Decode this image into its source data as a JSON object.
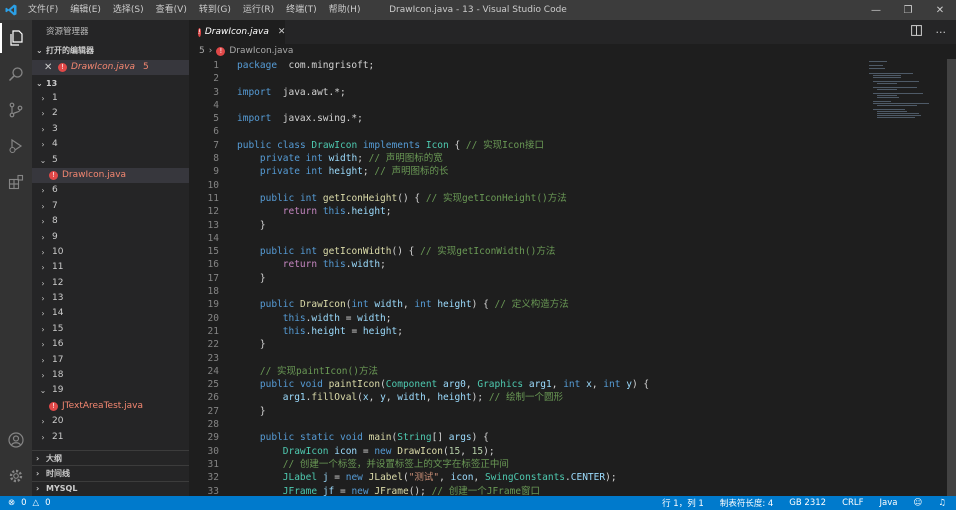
{
  "titlebar": {
    "menu": [
      "文件(F)",
      "编辑(E)",
      "选择(S)",
      "查看(V)",
      "转到(G)",
      "运行(R)",
      "终端(T)",
      "帮助(H)"
    ],
    "window_title": "DrawIcon.java - 13 - Visual Studio Code"
  },
  "sidebar": {
    "title": "资源管理器",
    "open_editors_label": "打开的编辑器",
    "open_editor": {
      "name": "DrawIcon.java",
      "badge": "5"
    },
    "workspace_label": "13",
    "tree": [
      {
        "label": "1",
        "type": "folder",
        "open": false
      },
      {
        "label": "2",
        "type": "folder",
        "open": false
      },
      {
        "label": "3",
        "type": "folder",
        "open": false
      },
      {
        "label": "4",
        "type": "folder",
        "open": false
      },
      {
        "label": "5",
        "type": "folder",
        "open": true
      },
      {
        "label": "DrawIcon.java",
        "type": "file",
        "selected": true
      },
      {
        "label": "6",
        "type": "folder",
        "open": false
      },
      {
        "label": "7",
        "type": "folder",
        "open": false
      },
      {
        "label": "8",
        "type": "folder",
        "open": false
      },
      {
        "label": "9",
        "type": "folder",
        "open": false
      },
      {
        "label": "10",
        "type": "folder",
        "open": false
      },
      {
        "label": "11",
        "type": "folder",
        "open": false
      },
      {
        "label": "12",
        "type": "folder",
        "open": false
      },
      {
        "label": "13",
        "type": "folder",
        "open": false
      },
      {
        "label": "14",
        "type": "folder",
        "open": false
      },
      {
        "label": "15",
        "type": "folder",
        "open": false
      },
      {
        "label": "16",
        "type": "folder",
        "open": false
      },
      {
        "label": "17",
        "type": "folder",
        "open": false
      },
      {
        "label": "18",
        "type": "folder",
        "open": false
      },
      {
        "label": "19",
        "type": "folder",
        "open": true
      },
      {
        "label": "JTextAreaTest.java",
        "type": "file",
        "selected": false
      },
      {
        "label": "20",
        "type": "folder",
        "open": false
      },
      {
        "label": "21",
        "type": "folder",
        "open": false
      }
    ],
    "bottom_sections": [
      "大纲",
      "时间线",
      "MYSQL"
    ]
  },
  "editor": {
    "tab_label": "DrawIcon.java",
    "breadcrumb_folder": "5",
    "breadcrumb_file": "DrawIcon.java",
    "lines": [
      [
        [
          "kw",
          "package"
        ],
        [
          "",
          "  com.mingrisoft;"
        ]
      ],
      [],
      [
        [
          "kw",
          "import"
        ],
        [
          "",
          "  java.awt.*;"
        ]
      ],
      [],
      [
        [
          "kw",
          "import"
        ],
        [
          "",
          "  javax.swing.*;"
        ]
      ],
      [],
      [
        [
          "kw",
          "public"
        ],
        [
          "",
          " "
        ],
        [
          "kw",
          "class"
        ],
        [
          "",
          " "
        ],
        [
          "ty",
          "DrawIcon"
        ],
        [
          "",
          " "
        ],
        [
          "kw",
          "implements"
        ],
        [
          "",
          " "
        ],
        [
          "ty",
          "Icon"
        ],
        [
          "",
          " { "
        ],
        [
          "cm",
          "// 实现Icon接口"
        ]
      ],
      [
        [
          "",
          "    "
        ],
        [
          "kw",
          "private"
        ],
        [
          "",
          " "
        ],
        [
          "kw",
          "int"
        ],
        [
          "",
          " "
        ],
        [
          "vr",
          "width"
        ],
        [
          "",
          "; "
        ],
        [
          "cm",
          "// 声明图标的宽"
        ]
      ],
      [
        [
          "",
          "    "
        ],
        [
          "kw",
          "private"
        ],
        [
          "",
          " "
        ],
        [
          "kw",
          "int"
        ],
        [
          "",
          " "
        ],
        [
          "vr",
          "height"
        ],
        [
          "",
          "; "
        ],
        [
          "cm",
          "// 声明图标的长"
        ]
      ],
      [],
      [
        [
          "",
          "    "
        ],
        [
          "kw",
          "public"
        ],
        [
          "",
          " "
        ],
        [
          "kw",
          "int"
        ],
        [
          "",
          " "
        ],
        [
          "fn",
          "getIconHeight"
        ],
        [
          "",
          "() { "
        ],
        [
          "cm",
          "// 实现getIconHeight()方法"
        ]
      ],
      [
        [
          "",
          "        "
        ],
        [
          "kw2",
          "return"
        ],
        [
          "",
          " "
        ],
        [
          "kw",
          "this"
        ],
        [
          "",
          "."
        ],
        [
          "vr",
          "height"
        ],
        [
          "",
          ";"
        ]
      ],
      [
        [
          "",
          "    }"
        ]
      ],
      [],
      [
        [
          "",
          "    "
        ],
        [
          "kw",
          "public"
        ],
        [
          "",
          " "
        ],
        [
          "kw",
          "int"
        ],
        [
          "",
          " "
        ],
        [
          "fn",
          "getIconWidth"
        ],
        [
          "",
          "() { "
        ],
        [
          "cm",
          "// 实现getIconWidth()方法"
        ]
      ],
      [
        [
          "",
          "        "
        ],
        [
          "kw2",
          "return"
        ],
        [
          "",
          " "
        ],
        [
          "kw",
          "this"
        ],
        [
          "",
          "."
        ],
        [
          "vr",
          "width"
        ],
        [
          "",
          ";"
        ]
      ],
      [
        [
          "",
          "    }"
        ]
      ],
      [],
      [
        [
          "",
          "    "
        ],
        [
          "kw",
          "public"
        ],
        [
          "",
          " "
        ],
        [
          "fn",
          "DrawIcon"
        ],
        [
          "",
          "("
        ],
        [
          "kw",
          "int"
        ],
        [
          "",
          " "
        ],
        [
          "vr",
          "width"
        ],
        [
          ", ",
          ", "
        ],
        [
          "kw",
          "int"
        ],
        [
          "",
          " "
        ],
        [
          "vr",
          "height"
        ],
        [
          "",
          ") { "
        ],
        [
          "cm",
          "// 定义构造方法"
        ]
      ],
      [
        [
          "",
          "        "
        ],
        [
          "kw",
          "this"
        ],
        [
          "",
          "."
        ],
        [
          "vr",
          "width"
        ],
        [
          "",
          " = "
        ],
        [
          "vr",
          "width"
        ],
        [
          "",
          ";"
        ]
      ],
      [
        [
          "",
          "        "
        ],
        [
          "kw",
          "this"
        ],
        [
          "",
          "."
        ],
        [
          "vr",
          "height"
        ],
        [
          "",
          " = "
        ],
        [
          "vr",
          "height"
        ],
        [
          "",
          ";"
        ]
      ],
      [
        [
          "",
          "    }"
        ]
      ],
      [],
      [
        [
          "",
          "    "
        ],
        [
          "cm",
          "// 实现paintIcon()方法"
        ]
      ],
      [
        [
          "",
          "    "
        ],
        [
          "kw",
          "public"
        ],
        [
          "",
          " "
        ],
        [
          "kw",
          "void"
        ],
        [
          "",
          " "
        ],
        [
          "fn",
          "paintIcon"
        ],
        [
          "",
          "("
        ],
        [
          "ty",
          "Component"
        ],
        [
          "",
          " "
        ],
        [
          "vr",
          "arg0"
        ],
        [
          "",
          ", "
        ],
        [
          "ty",
          "Graphics"
        ],
        [
          "",
          " "
        ],
        [
          "vr",
          "arg1"
        ],
        [
          "",
          ", "
        ],
        [
          "kw",
          "int"
        ],
        [
          "",
          " "
        ],
        [
          "vr",
          "x"
        ],
        [
          "",
          ", "
        ],
        [
          "kw",
          "int"
        ],
        [
          "",
          " "
        ],
        [
          "vr",
          "y"
        ],
        [
          "",
          ") {"
        ]
      ],
      [
        [
          "",
          "        "
        ],
        [
          "vr",
          "arg1"
        ],
        [
          "",
          "."
        ],
        [
          "fn",
          "fillOval"
        ],
        [
          "",
          "("
        ],
        [
          "vr",
          "x"
        ],
        [
          "",
          ", "
        ],
        [
          "vr",
          "y"
        ],
        [
          "",
          ", "
        ],
        [
          "vr",
          "width"
        ],
        [
          "",
          ", "
        ],
        [
          "vr",
          "height"
        ],
        [
          "",
          "); "
        ],
        [
          "cm",
          "// 绘制一个圆形"
        ]
      ],
      [
        [
          "",
          "    }"
        ]
      ],
      [],
      [
        [
          "",
          "    "
        ],
        [
          "kw",
          "public"
        ],
        [
          "",
          " "
        ],
        [
          "kw",
          "static"
        ],
        [
          "",
          " "
        ],
        [
          "kw",
          "void"
        ],
        [
          "",
          " "
        ],
        [
          "fn",
          "main"
        ],
        [
          "",
          "("
        ],
        [
          "ty",
          "String"
        ],
        [
          "",
          "[] "
        ],
        [
          "vr",
          "args"
        ],
        [
          "",
          ") {"
        ]
      ],
      [
        [
          "",
          "        "
        ],
        [
          "ty",
          "DrawIcon"
        ],
        [
          "",
          " "
        ],
        [
          "vr",
          "icon"
        ],
        [
          "",
          " = "
        ],
        [
          "kw",
          "new"
        ],
        [
          "",
          " "
        ],
        [
          "fn",
          "DrawIcon"
        ],
        [
          "",
          "("
        ],
        [
          "nu",
          "15"
        ],
        [
          "",
          ", "
        ],
        [
          "nu",
          "15"
        ],
        [
          "",
          ");"
        ]
      ],
      [
        [
          "",
          "        "
        ],
        [
          "cm",
          "// 创建一个标签，并设置标签上的文字在标签正中间"
        ]
      ],
      [
        [
          "",
          "        "
        ],
        [
          "ty",
          "JLabel"
        ],
        [
          "",
          " "
        ],
        [
          "vr",
          "j"
        ],
        [
          "",
          " = "
        ],
        [
          "kw",
          "new"
        ],
        [
          "",
          " "
        ],
        [
          "fn",
          "JLabel"
        ],
        [
          "",
          "("
        ],
        [
          "st",
          "\"测试\""
        ],
        [
          "",
          ", "
        ],
        [
          "vr",
          "icon"
        ],
        [
          "",
          ", "
        ],
        [
          "ty",
          "SwingConstants"
        ],
        [
          "",
          "."
        ],
        [
          "vr",
          "CENTER"
        ],
        [
          "",
          ");"
        ]
      ],
      [
        [
          "",
          "        "
        ],
        [
          "ty",
          "JFrame"
        ],
        [
          "",
          " "
        ],
        [
          "vr",
          "jf"
        ],
        [
          "",
          " = "
        ],
        [
          "kw",
          "new"
        ],
        [
          "",
          " "
        ],
        [
          "fn",
          "JFrame"
        ],
        [
          "",
          "(); "
        ],
        [
          "cm",
          "// 创建一个JFrame窗口"
        ]
      ]
    ]
  },
  "status": {
    "errors": "0",
    "warnings": "0",
    "position": "行 1，列 1",
    "tab_size": "制表符长度: 4",
    "encoding": "GB 2312",
    "eol": "CRLF",
    "language": "Java"
  }
}
